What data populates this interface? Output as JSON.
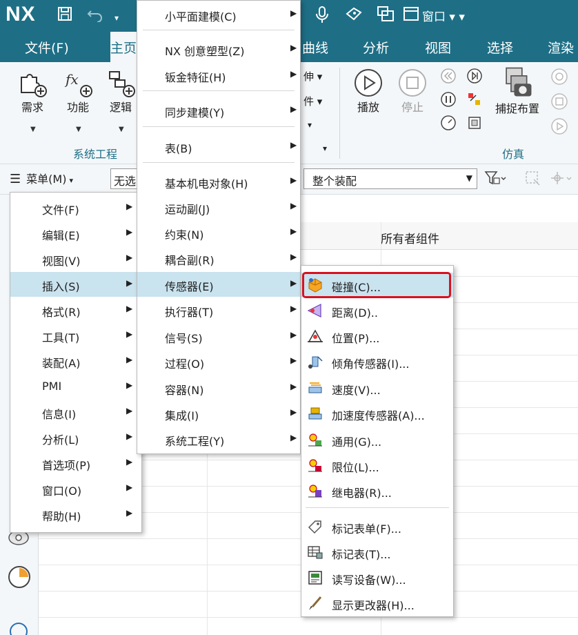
{
  "titlebar": {
    "logo": "NX",
    "window_label": "窗口"
  },
  "ribbon_tabs": [
    "文件(F)",
    "主页",
    "曲线",
    "分析",
    "视图",
    "选择",
    "渲染"
  ],
  "ribbon": {
    "left_buttons": [
      "需求",
      "功能",
      "逻辑"
    ],
    "left_group": "系统工程",
    "right_buttons": {
      "play": "播放",
      "stop": "停止",
      "capture": "捕捉布置"
    },
    "right_group": "仿真",
    "partial_items": [
      "伸",
      "件"
    ]
  },
  "cmdbar": {
    "menu_button": "菜单(M)",
    "filter_value": "无选",
    "scope_value": "整个装配"
  },
  "table": {
    "owner_column": "所有者组件"
  },
  "menu_level1": [
    {
      "label": "文件(F)",
      "highlighted": false
    },
    {
      "label": "编辑(E)",
      "highlighted": false
    },
    {
      "label": "视图(V)",
      "highlighted": false
    },
    {
      "label": "插入(S)",
      "highlighted": true
    },
    {
      "label": "格式(R)",
      "highlighted": false
    },
    {
      "label": "工具(T)",
      "highlighted": false
    },
    {
      "label": "装配(A)",
      "highlighted": false
    },
    {
      "label": "PMI",
      "highlighted": false
    },
    {
      "label": "信息(I)",
      "highlighted": false
    },
    {
      "label": "分析(L)",
      "highlighted": false
    },
    {
      "label": "首选项(P)",
      "highlighted": false
    },
    {
      "label": "窗口(O)",
      "highlighted": false
    },
    {
      "label": "帮助(H)",
      "highlighted": false
    }
  ],
  "menu_level2": [
    {
      "label": "小平面建模(C)",
      "highlighted": false
    },
    {
      "label": "NX 创意塑型(Z)",
      "highlighted": false
    },
    {
      "label": "钣金特征(H)",
      "highlighted": false
    },
    {
      "label": "同步建模(Y)",
      "highlighted": false
    },
    {
      "label": "表(B)",
      "highlighted": false
    },
    {
      "label": "基本机电对象(H)",
      "highlighted": false
    },
    {
      "label": "运动副(J)",
      "highlighted": false
    },
    {
      "label": "约束(N)",
      "highlighted": false
    },
    {
      "label": "耦合副(R)",
      "highlighted": false
    },
    {
      "label": "传感器(E)",
      "highlighted": true
    },
    {
      "label": "执行器(T)",
      "highlighted": false
    },
    {
      "label": "信号(S)",
      "highlighted": false
    },
    {
      "label": "过程(O)",
      "highlighted": false
    },
    {
      "label": "容器(N)",
      "highlighted": false
    },
    {
      "label": "集成(I)",
      "highlighted": false
    },
    {
      "label": "系统工程(Y)",
      "highlighted": false
    }
  ],
  "menu_level3": [
    {
      "label": "碰撞(C)...",
      "icon": "collision-sensor-icon",
      "highlighted": true
    },
    {
      "label": "距离(D)..",
      "icon": "distance-sensor-icon",
      "highlighted": false
    },
    {
      "label": "位置(P)...",
      "icon": "position-sensor-icon",
      "highlighted": false
    },
    {
      "label": "倾角传感器(I)...",
      "icon": "inclinometer-icon",
      "highlighted": false
    },
    {
      "label": "速度(V)...",
      "icon": "velocity-sensor-icon",
      "highlighted": false
    },
    {
      "label": "加速度传感器(A)...",
      "icon": "accelerometer-icon",
      "highlighted": false
    },
    {
      "label": "通用(G)...",
      "icon": "generic-sensor-icon",
      "highlighted": false
    },
    {
      "label": "限位(L)...",
      "icon": "limit-switch-icon",
      "highlighted": false
    },
    {
      "label": "继电器(R)...",
      "icon": "relay-icon",
      "highlighted": false
    },
    {
      "label": "标记表单(F)...",
      "icon": "tag-form-icon",
      "highlighted": false
    },
    {
      "label": "标记表(T)...",
      "icon": "tag-table-icon",
      "highlighted": false
    },
    {
      "label": "读写设备(W)...",
      "icon": "read-write-device-icon",
      "highlighted": false
    },
    {
      "label": "显示更改器(H)...",
      "icon": "display-changer-icon",
      "highlighted": false
    }
  ],
  "colors": {
    "titlebar": "#1e6f86",
    "menu_highlight": "#c9e3ef",
    "callout_border": "#d9111e"
  }
}
